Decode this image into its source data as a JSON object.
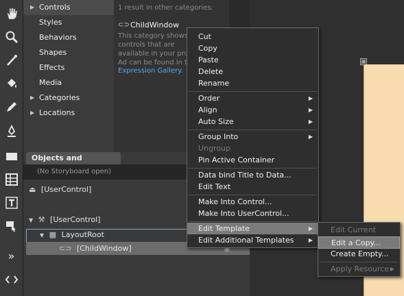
{
  "assets": {
    "categories": [
      {
        "label": "Controls",
        "arrow": "▶"
      },
      {
        "label": "Styles",
        "arrow": ""
      },
      {
        "label": "Behaviors",
        "arrow": ""
      },
      {
        "label": "Shapes",
        "arrow": ""
      },
      {
        "label": "Effects",
        "arrow": ""
      },
      {
        "label": "Media",
        "arrow": ""
      },
      {
        "label": "Categories",
        "arrow": "▶"
      },
      {
        "label": "Locations",
        "arrow": "▶"
      }
    ],
    "result_note": "1 result in other categories.",
    "result_item": "ChildWindow",
    "description": "This category shows controls that are available in your project. Ad can be found in th",
    "gallery_link": "Expression Gallery."
  },
  "objects": {
    "tab_label": "Objects and Timeline",
    "storyboard": "(No Storyboard open)",
    "usercontrol_top": "[UserControl]",
    "usercontrol_tree": "[UserControl]",
    "layoutroot": "LayoutRoot",
    "childwindow": "[ChildWindow]"
  },
  "context_menu": {
    "items": [
      {
        "label": "Cut"
      },
      {
        "label": "Copy"
      },
      {
        "label": "Paste"
      },
      {
        "label": "Delete"
      },
      {
        "label": "Rename"
      },
      {
        "label": "Order",
        "submenu": "▶"
      },
      {
        "label": "Align",
        "submenu": "▶"
      },
      {
        "label": "Auto Size",
        "submenu": "▶"
      },
      {
        "label": "Group Into",
        "submenu": "▶"
      },
      {
        "label": "Ungroup"
      },
      {
        "label": "Pin Active Container"
      },
      {
        "label": "Data bind Title to Data..."
      },
      {
        "label": "Edit Text"
      },
      {
        "label": "Make Into Control..."
      },
      {
        "label": "Make Into UserControl..."
      },
      {
        "label": "Edit Template",
        "submenu": "▶"
      },
      {
        "label": "Edit Additional Templates",
        "submenu": "▶"
      }
    ]
  },
  "submenu": {
    "items": [
      {
        "label": "Edit Current"
      },
      {
        "label": "Edit a Copy..."
      },
      {
        "label": "Create Empty..."
      },
      {
        "label": "Apply Resource",
        "submenu": "▶"
      }
    ]
  },
  "icons": {
    "expand_arrow": "▶",
    "tree_collapse": "▼",
    "more_tools": "»"
  },
  "colors": {
    "accent_link": "#5aa8e8",
    "artboard_fill": "#f8dcb0",
    "selection_border": "#7aa8d8"
  }
}
